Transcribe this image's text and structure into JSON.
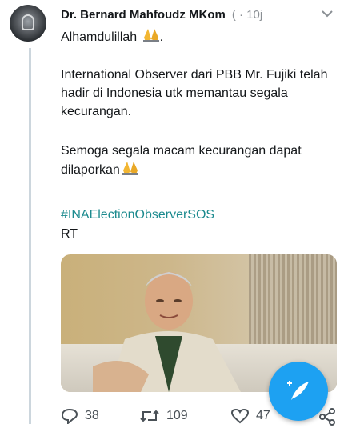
{
  "tweet": {
    "author_name": "Dr. Bernard Mahfoudz MKom",
    "meta": "( · 10j",
    "line1": "Alhamdulillah",
    "paragraph1": "International Observer dari PBB Mr. Fujiki telah hadir di Indonesia utk memantau segala kecurangan.",
    "paragraph2": "Semoga segala macam kecurangan dapat dilaporkan",
    "hashtag": "#INAElectionObserverSOS",
    "rt": "RT"
  },
  "actions": {
    "reply_count": "38",
    "retweet_count": "109",
    "like_count": "47"
  },
  "icons": {
    "more": "chevron-down-icon",
    "compose": "compose-tweet-icon",
    "reply": "reply-icon",
    "retweet": "retweet-icon",
    "like": "heart-icon",
    "share": "share-icon",
    "pray": "folded-hands-emoji"
  },
  "colors": {
    "accent": "#1da1f2",
    "hashtag": "#1b8a8e",
    "muted": "#8a8f94"
  }
}
